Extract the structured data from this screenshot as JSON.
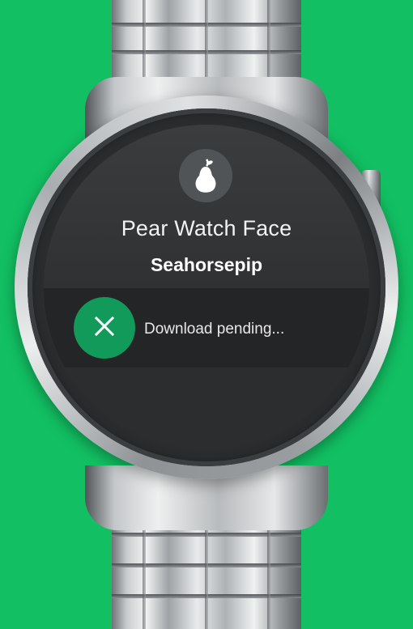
{
  "app": {
    "title": "Pear Watch Face",
    "developer": "Seahorsepip"
  },
  "download": {
    "status": "Download pending..."
  },
  "icons": {
    "app_icon": "pear-icon",
    "cancel": "close-icon"
  },
  "colors": {
    "background": "#12c063",
    "accent_button": "#119a5a",
    "screen": "#2f3133"
  }
}
